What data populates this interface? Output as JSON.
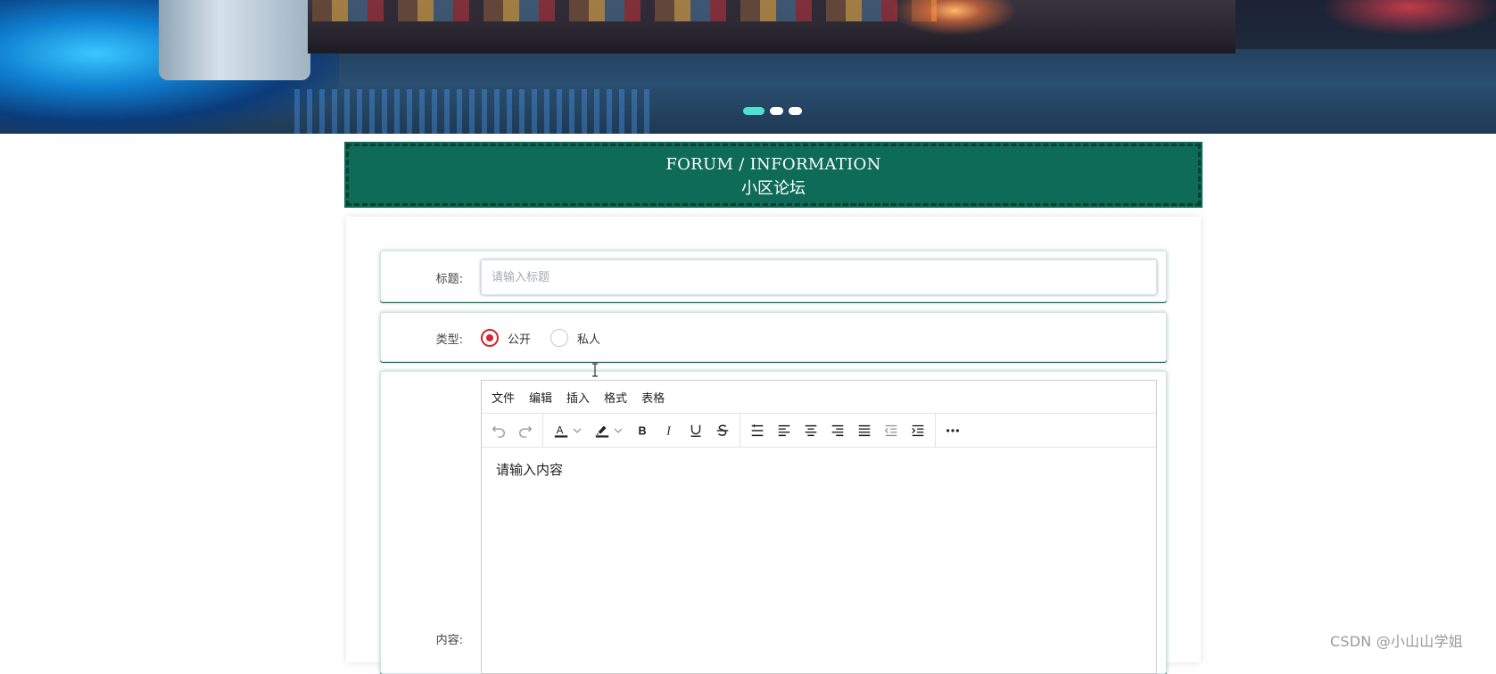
{
  "banner": {
    "slide_indicators": [
      {
        "name": "slide-1",
        "active": true
      },
      {
        "name": "slide-2",
        "active": false
      },
      {
        "name": "slide-3",
        "active": false
      }
    ],
    "active_color": "#4fe0d0"
  },
  "section": {
    "title_en": "FORUM / INFORMATION",
    "title_zh": "小区论坛",
    "bg_color": "#0e6b57"
  },
  "form": {
    "title": {
      "label": "标题:",
      "placeholder": "请输入标题",
      "value": ""
    },
    "type": {
      "label": "类型:",
      "options": [
        {
          "label": "公开",
          "checked": true
        },
        {
          "label": "私人",
          "checked": false
        }
      ],
      "checked_color": "#d6262b"
    },
    "content": {
      "label": "内容:",
      "editor": {
        "menus": [
          "文件",
          "编辑",
          "插入",
          "格式",
          "表格"
        ],
        "toolbar_icons": [
          "undo-icon",
          "redo-icon",
          "text-color-icon",
          "highlight-color-icon",
          "bold-icon",
          "italic-icon",
          "underline-icon",
          "strikethrough-icon",
          "line-height-icon",
          "align-left-icon",
          "align-center-icon",
          "align-right-icon",
          "align-justify-icon",
          "outdent-icon",
          "indent-icon",
          "more-icon"
        ],
        "placeholder": "请输入内容"
      }
    }
  },
  "watermark": "CSDN @小山山学姐"
}
